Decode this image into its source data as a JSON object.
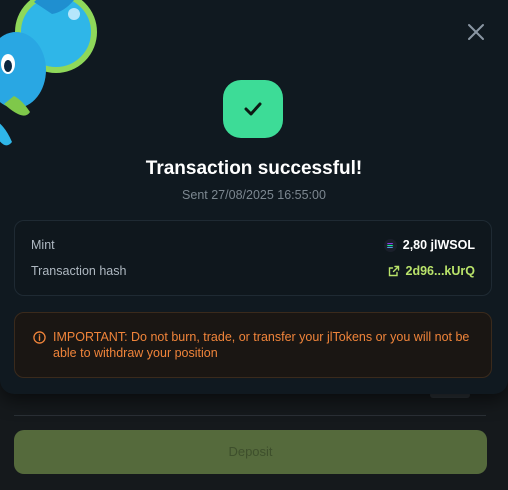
{
  "background": {
    "deposit_label": "Deposit"
  },
  "modal": {
    "title": "Transaction successful!",
    "sent": "Sent 27/08/2025 16:55:00",
    "details": {
      "mint_label": "Mint",
      "mint_value": "2,80 jlWSOL",
      "hash_label": "Transaction hash",
      "hash_value": "2d96...kUrQ"
    },
    "warning": "IMPORTANT: Do not burn, trade, or transfer your jlTokens or you will not be able to withdraw your position",
    "icons": {
      "close": "close-icon",
      "success": "checkmark-icon",
      "token": "solana-icon",
      "link": "external-link-icon",
      "warning": "info-icon"
    }
  },
  "colors": {
    "success": "#3ddc97",
    "link": "#b9e36a",
    "warning": "#f0843a"
  }
}
